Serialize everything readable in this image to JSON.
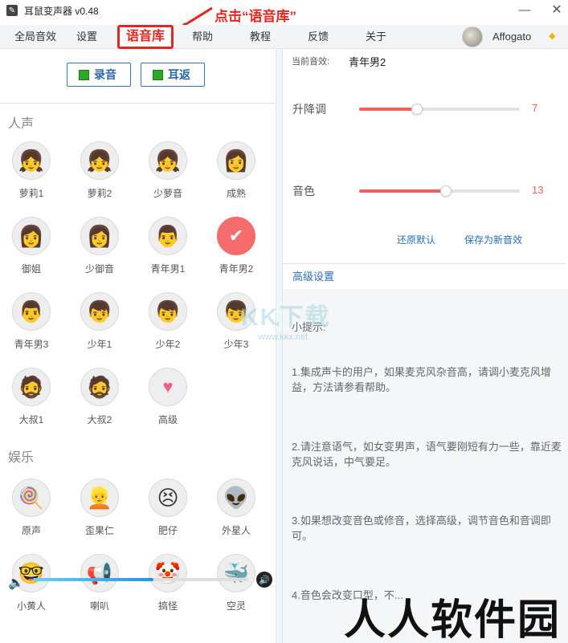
{
  "window": {
    "title": "耳鼠变声器 v0.48",
    "minimize_glyph": "—",
    "close_glyph": "✕"
  },
  "annotation": {
    "text": "点击“语音库”",
    "color": "#e8241f"
  },
  "menu": {
    "items": [
      {
        "label": "全局音效"
      },
      {
        "label": "设置"
      },
      {
        "label": "语音库"
      },
      {
        "label": "帮助"
      },
      {
        "label": "教程"
      },
      {
        "label": "反馈"
      },
      {
        "label": "关于"
      }
    ],
    "active_index": 2
  },
  "user": {
    "name": "Affogato"
  },
  "controls": {
    "record_label": "录音",
    "monitor_label": "耳返"
  },
  "sections": {
    "human_title": "人声",
    "entertainment_title": "娱乐"
  },
  "human_voices": [
    {
      "label": "萝莉1",
      "icon": "girl-face-icon",
      "glyph": "👧"
    },
    {
      "label": "萝莉2",
      "icon": "girl-face-icon",
      "glyph": "👧"
    },
    {
      "label": "少萝音",
      "icon": "girl-face-icon",
      "glyph": "👧"
    },
    {
      "label": "成熟",
      "icon": "woman-face-icon",
      "glyph": "👩"
    },
    {
      "label": "御姐",
      "icon": "woman-face-icon",
      "glyph": "👩"
    },
    {
      "label": "少御音",
      "icon": "woman-face-icon",
      "glyph": "👩"
    },
    {
      "label": "青年男1",
      "icon": "young-man-face-icon",
      "glyph": "👨"
    },
    {
      "label": "青年男2",
      "icon": "check-icon",
      "glyph": "✔",
      "selected": true
    },
    {
      "label": "青年男3",
      "icon": "young-man-face-icon",
      "glyph": "👨"
    },
    {
      "label": "少年1",
      "icon": "boy-face-icon",
      "glyph": "👦"
    },
    {
      "label": "少年2",
      "icon": "boy-face-icon",
      "glyph": "👦"
    },
    {
      "label": "少年3",
      "icon": "boy-face-icon",
      "glyph": "👦"
    },
    {
      "label": "大叔1",
      "icon": "mustache-man-face-icon",
      "glyph": "🧔"
    },
    {
      "label": "大叔2",
      "icon": "mustache-man-face-icon",
      "glyph": "🧔"
    },
    {
      "label": "高级",
      "icon": "heart-icon",
      "glyph": "♥"
    }
  ],
  "entertainment_voices": [
    {
      "label": "原声",
      "icon": "lollipop-icon",
      "glyph": "🍭"
    },
    {
      "label": "歪果仁",
      "icon": "foreigner-face-icon",
      "glyph": "👱"
    },
    {
      "label": "肥仔",
      "icon": "chubby-face-icon",
      "glyph": "😣"
    },
    {
      "label": "外星人",
      "icon": "alien-face-icon",
      "glyph": "👽"
    },
    {
      "label": "小黄人",
      "icon": "minion-face-icon",
      "glyph": "🤓"
    },
    {
      "label": "喇叭",
      "icon": "megaphone-icon",
      "glyph": "📢"
    },
    {
      "label": "搞怪",
      "icon": "jester-face-icon",
      "glyph": "🤡"
    },
    {
      "label": "空灵",
      "icon": "whale-icon",
      "glyph": "🐳"
    }
  ],
  "volume": {
    "level_fraction": 0.56
  },
  "current_effect": {
    "label": "当前音效:",
    "value": "青年男2"
  },
  "pitch": {
    "label": "升降调",
    "value": "7",
    "fraction": 0.36
  },
  "timbre": {
    "label": "音色",
    "value": "13",
    "fraction": 0.54
  },
  "actions": {
    "restore_default": "还原默认",
    "save_as_new": "保存为新音效"
  },
  "advanced": {
    "label": "高级设置"
  },
  "tips": {
    "title": "小提示:",
    "items": [
      "1.集成声卡的用户，如果麦克风杂音高，请调小麦克风增益，方法请参看帮助。",
      "2.请注意语气，如女变男声，语气要刚短有力一些，靠近麦克风说话，中气要足。",
      "3.如果想改变音色或修音，选择高级，调节音色和音调即可。",
      "4.音色会改变口型，不..."
    ]
  },
  "watermarks": {
    "kkx_big": "KK下载",
    "kkx_url": "www.kkx.net",
    "rrz": "人人软件园"
  }
}
